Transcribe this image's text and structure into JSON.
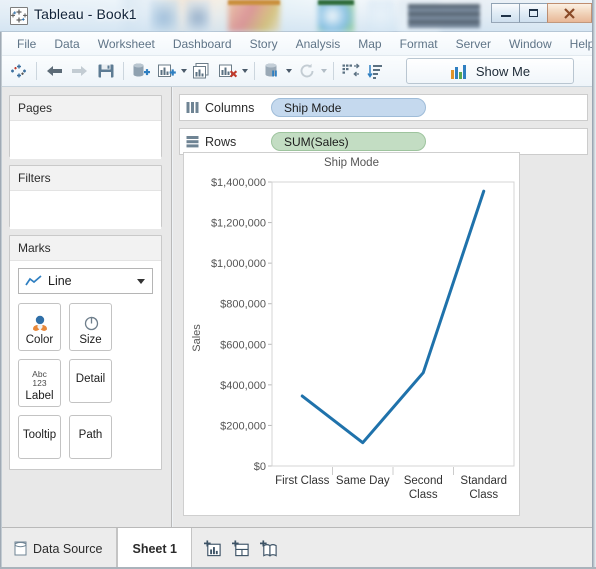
{
  "window": {
    "title": "Tableau - Book1",
    "app_icon": "tableau-logo-icon",
    "minimize_label": "Minimize",
    "maximize_label": "Maximize",
    "close_label": "Close"
  },
  "menubar": {
    "items": [
      {
        "label": "File",
        "name": "menu-file"
      },
      {
        "label": "Data",
        "name": "menu-data"
      },
      {
        "label": "Worksheet",
        "name": "menu-worksheet"
      },
      {
        "label": "Dashboard",
        "name": "menu-dashboard"
      },
      {
        "label": "Story",
        "name": "menu-story"
      },
      {
        "label": "Analysis",
        "name": "menu-analysis"
      },
      {
        "label": "Map",
        "name": "menu-map"
      },
      {
        "label": "Format",
        "name": "menu-format"
      },
      {
        "label": "Server",
        "name": "menu-server"
      },
      {
        "label": "Window",
        "name": "menu-window"
      },
      {
        "label": "Help",
        "name": "menu-help"
      }
    ]
  },
  "toolbar": {
    "buttons": [
      {
        "icon": "tableau-sparkle-icon",
        "label": "Start page"
      },
      {
        "icon": "arrow-back-icon",
        "label": "Undo"
      },
      {
        "icon": "arrow-forward-icon",
        "label": "Redo"
      },
      {
        "icon": "save-icon",
        "label": "Save"
      },
      {
        "icon": "new-data-source-icon",
        "label": "New Data Source"
      },
      {
        "icon": "new-worksheet-icon",
        "label": "New Worksheet"
      },
      {
        "icon": "duplicate-sheet-icon",
        "label": "Duplicate Sheet"
      },
      {
        "icon": "clear-sheet-icon",
        "label": "Clear Sheet"
      },
      {
        "icon": "pause-autoupdate-icon",
        "label": "Pause Auto Updates"
      },
      {
        "icon": "refresh-icon",
        "label": "Run Update"
      },
      {
        "icon": "swap-rows-cols-icon",
        "label": "Swap Rows and Columns"
      },
      {
        "icon": "sort-descending-icon",
        "label": "Sort"
      }
    ],
    "show_me_label": "Show Me",
    "show_me_icon": "show-me-bars-icon"
  },
  "sidebar": {
    "pages": {
      "title": "Pages"
    },
    "filters": {
      "title": "Filters"
    },
    "marks": {
      "title": "Marks",
      "mark_type": "Line",
      "mark_type_icon": "line-chart-icon",
      "buttons": [
        {
          "label": "Color",
          "icon": "color-palette-icon"
        },
        {
          "label": "Size",
          "icon": "size-circle-icon"
        },
        {
          "label": "Label",
          "icon": "abc-123-icon",
          "icon_line1": "Abc",
          "icon_line2": "123"
        },
        {
          "label": "Detail",
          "icon": "detail-icon"
        },
        {
          "label": "Tooltip",
          "icon": "tooltip-icon"
        },
        {
          "label": "Path",
          "icon": "path-icon"
        }
      ]
    }
  },
  "shelves": {
    "columns": {
      "label": "Columns",
      "icon": "columns-icon",
      "pill": "Ship Mode",
      "pill_color": "#c5d9ee"
    },
    "rows": {
      "label": "Rows",
      "icon": "rows-icon",
      "pill": "SUM(Sales)",
      "pill_color": "#c3ddc3"
    }
  },
  "bottombar": {
    "data_source_label": "Data Source",
    "data_source_icon": "data-source-icon",
    "sheet_tab_label": "Sheet 1",
    "new_worksheet_icon": "new-worksheet-tab-icon",
    "new_dashboard_icon": "new-dashboard-tab-icon",
    "new_story_icon": "new-story-tab-icon"
  },
  "chart_data": {
    "type": "line",
    "title": "Ship Mode",
    "xlabel": "",
    "ylabel": "Sales",
    "categories": [
      "First Class",
      "Same Day",
      "Second Class",
      "Standard Class"
    ],
    "values": [
      345000,
      115000,
      460000,
      1355000
    ],
    "ytick_labels": [
      "$1,400,000",
      "$1,200,000",
      "$1,000,000",
      "$800,000",
      "$600,000",
      "$400,000",
      "$200,000",
      "$0"
    ],
    "ytick_values": [
      1400000,
      1200000,
      1000000,
      800000,
      600000,
      400000,
      200000,
      0
    ],
    "ylim": [
      0,
      1400000
    ],
    "grid": false,
    "legend": "none",
    "line_color": "#1f72ab",
    "line_width": 3
  }
}
